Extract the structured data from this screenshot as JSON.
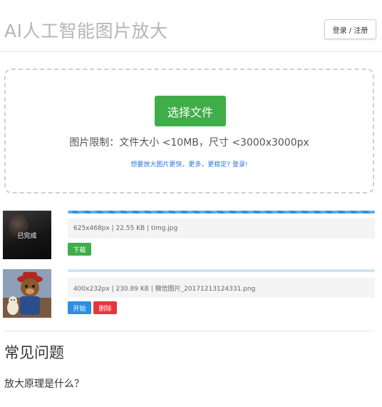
{
  "header": {
    "title": "AI人工智能图片放大",
    "login_label": "登录 / 注册"
  },
  "upload": {
    "choose_file_label": "选择文件",
    "limit_text": "图片限制：文件大小 <10MB，尺寸 <3000x3000px",
    "login_prompt": "想要放大图片更快，更多，更稳定? 登录!"
  },
  "files": [
    {
      "thumb_label": "已完成",
      "info": "625x468px | 22.55 KB | timg.jpg",
      "progress": 1.0,
      "download_label": "下载"
    },
    {
      "info": "400x232px | 230.89 KB | 微信图片_20171213124331.png",
      "progress": 0.0,
      "start_label": "开始",
      "delete_label": "删除"
    }
  ],
  "faq": {
    "title": "常见问题",
    "question1": "放大原理是什么？"
  },
  "colors": {
    "primary_green": "#3fae49",
    "progress_blue": "#2f8fde",
    "start_blue": "#2d8fe0",
    "delete_red": "#e8343f",
    "link_blue": "#2a7ad2"
  }
}
